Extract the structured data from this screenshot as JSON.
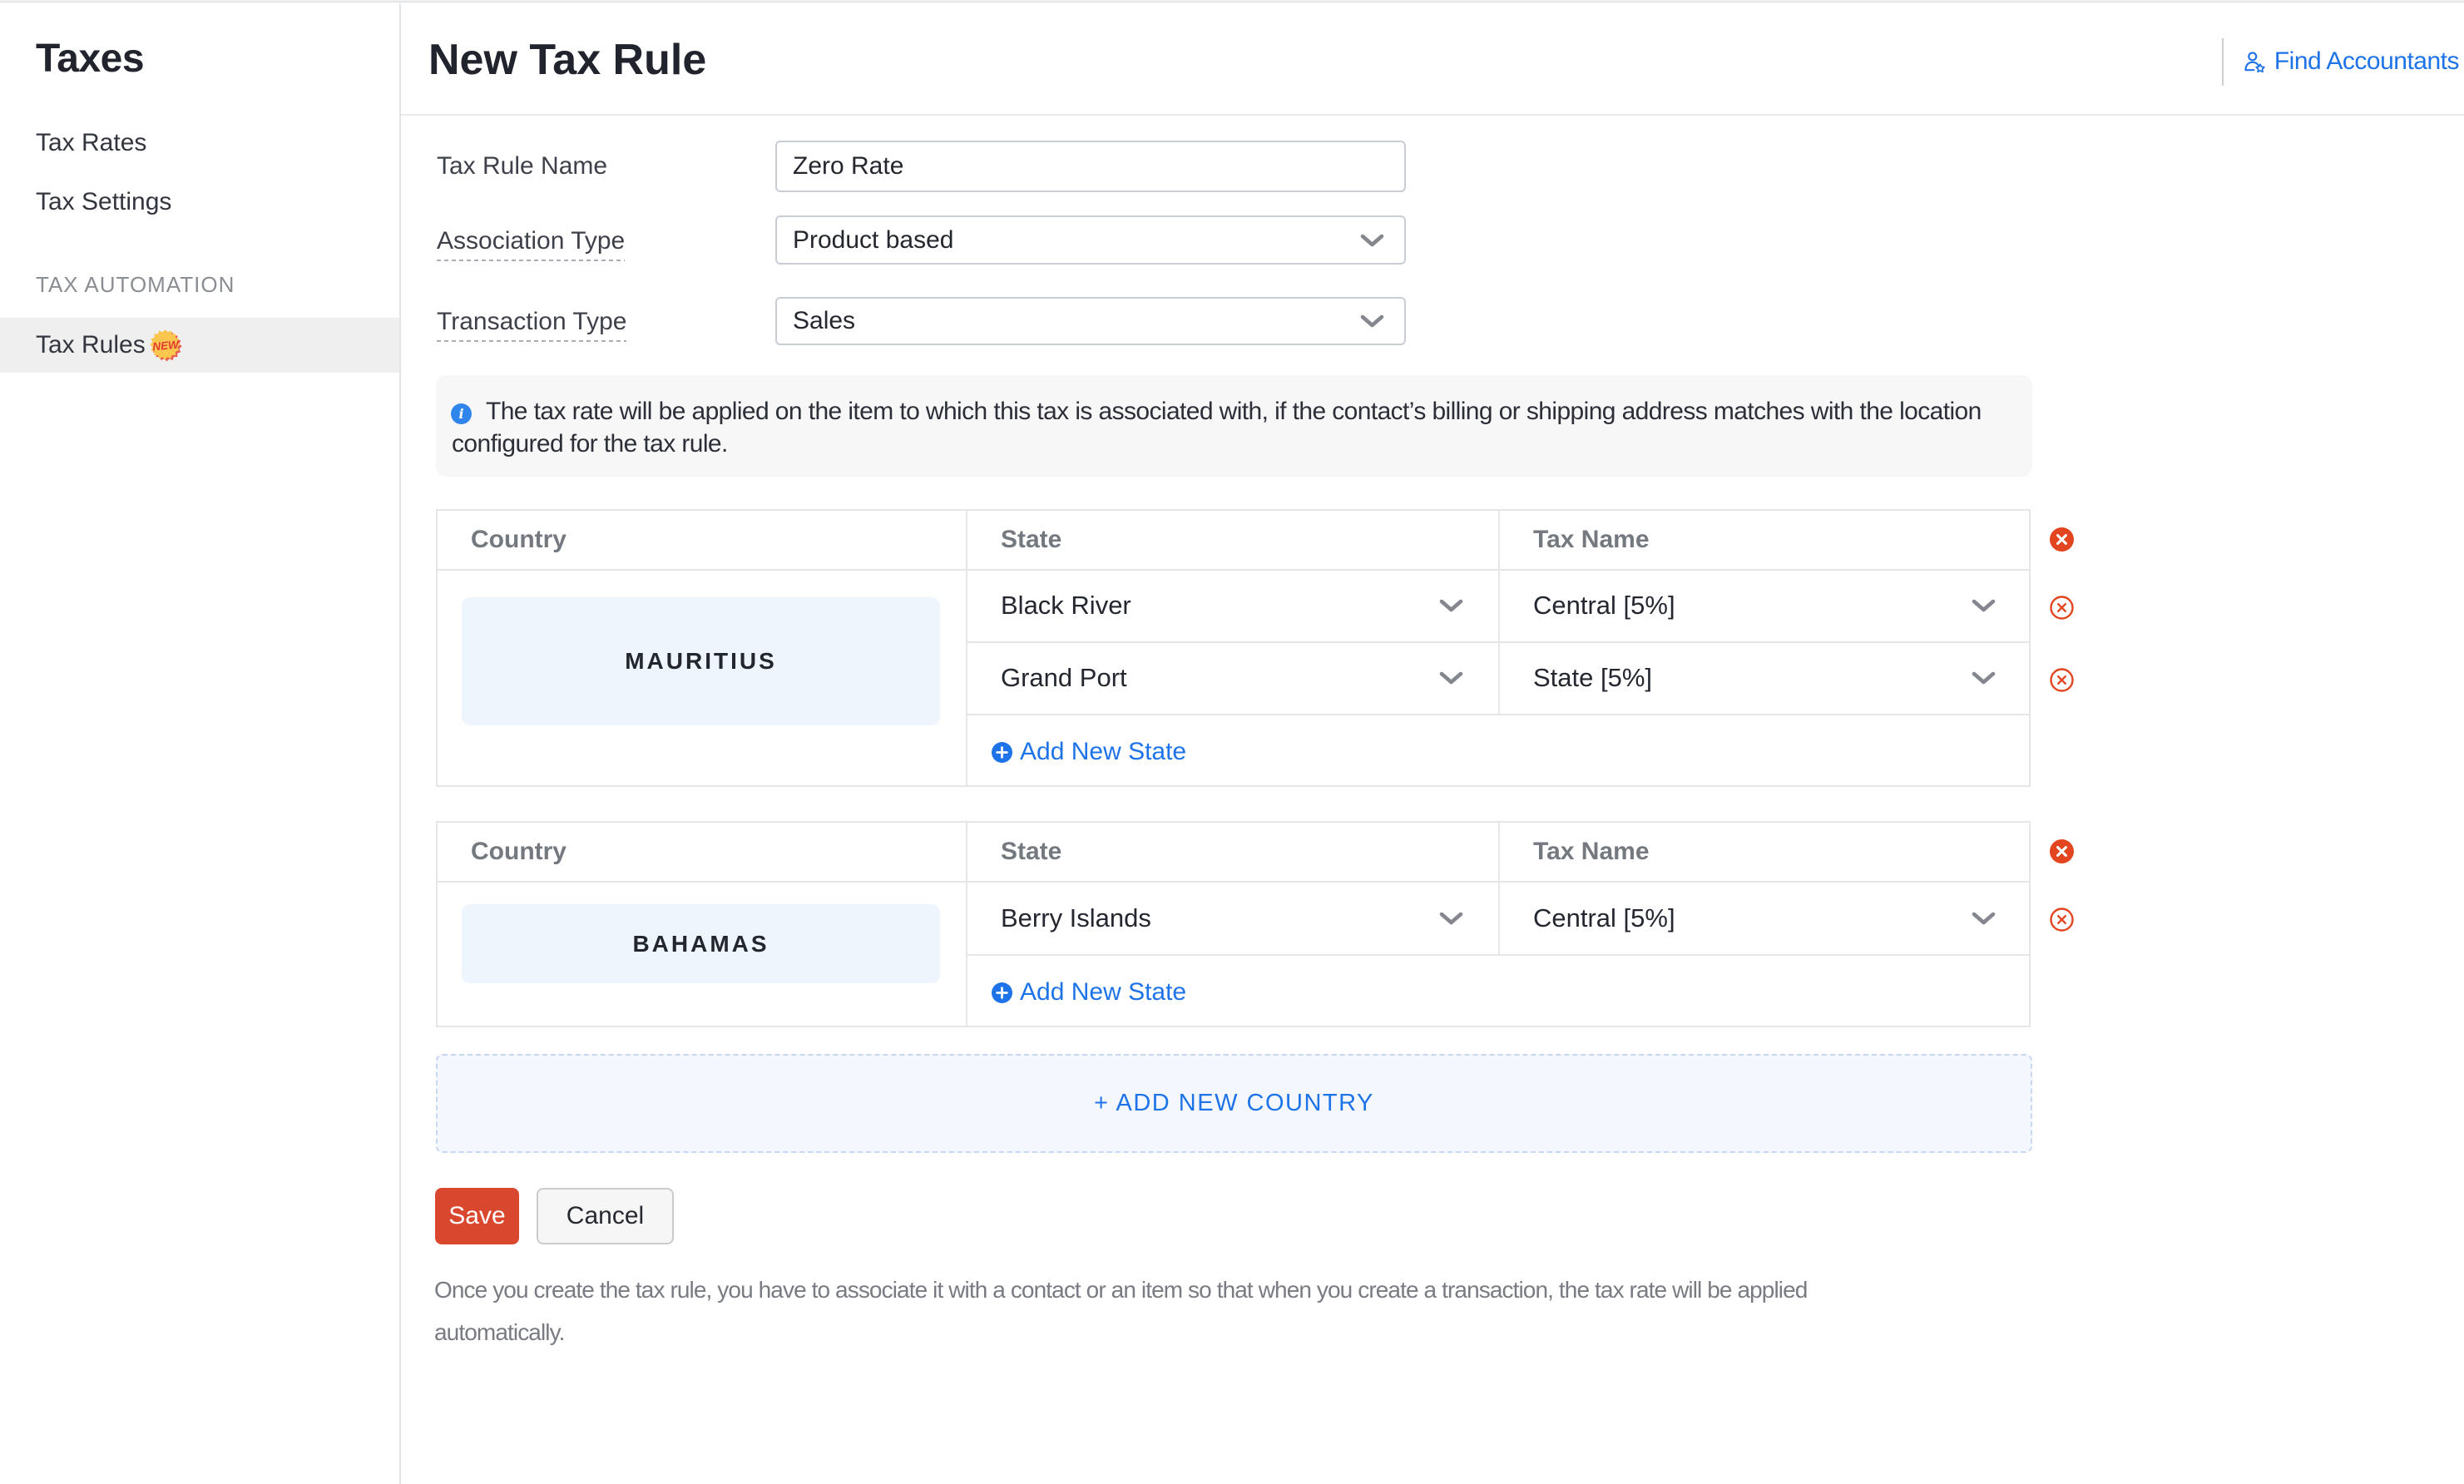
{
  "sidebar": {
    "title": "Taxes",
    "items": [
      {
        "label": "Tax Rates"
      },
      {
        "label": "Tax Settings"
      }
    ],
    "section_label": "TAX AUTOMATION",
    "active_item": {
      "label": "Tax Rules",
      "badge": "NEW"
    }
  },
  "header": {
    "title": "New Tax Rule",
    "find_accountants_label": "Find Accountants"
  },
  "form": {
    "tax_rule_name": {
      "label": "Tax Rule Name",
      "value": "Zero Rate"
    },
    "association_type": {
      "label": "Association Type",
      "value": "Product based"
    },
    "transaction_type": {
      "label": "Transaction Type",
      "value": "Sales"
    },
    "info_note": {
      "text": "The tax rate will be applied on the item to which this tax is associated with, if the contact’s billing or shipping address matches with the location configured for the tax rule.",
      "lines": [
        "The tax rate will be applied on the item to which this tax is associated with, if the contact’s billing or shipping address matches with the location",
        "configured for the tax rule."
      ]
    }
  },
  "tables": [
    {
      "headers": {
        "country": "Country",
        "state": "State",
        "tax_name": "Tax Name"
      },
      "country": "MAURITIUS",
      "rows": [
        {
          "state": "Black River",
          "tax": "Central [5%]"
        },
        {
          "state": "Grand Port",
          "tax": "State [5%]"
        }
      ],
      "add_state_label": "Add New State"
    },
    {
      "headers": {
        "country": "Country",
        "state": "State",
        "tax_name": "Tax Name"
      },
      "country": "BAHAMAS",
      "rows": [
        {
          "state": "Berry Islands",
          "tax": "Central [5%]"
        }
      ],
      "add_state_label": "Add New State"
    }
  ],
  "add_country_label": "+ ADD NEW COUNTRY",
  "buttons": {
    "save": "Save",
    "cancel": "Cancel"
  },
  "footer": {
    "text": "Once you create the tax rule, you have to associate it with a contact or an item so that when you create a transaction, the tax rate will be applied automatically.",
    "lines": [
      "Once you create the tax rule, you have to associate it with a contact or an item so that when you create a transaction, the tax rate will be applied",
      "automatically."
    ]
  },
  "colors": {
    "accent-blue": "#1e73e8",
    "info-blue": "#2f85ec",
    "danger-red": "#e2451f",
    "save-red": "#d9472e",
    "badge-yellow": "#fbc64e",
    "badge-text-red": "#e03a31",
    "country-box-blue": "#eef5fd"
  }
}
